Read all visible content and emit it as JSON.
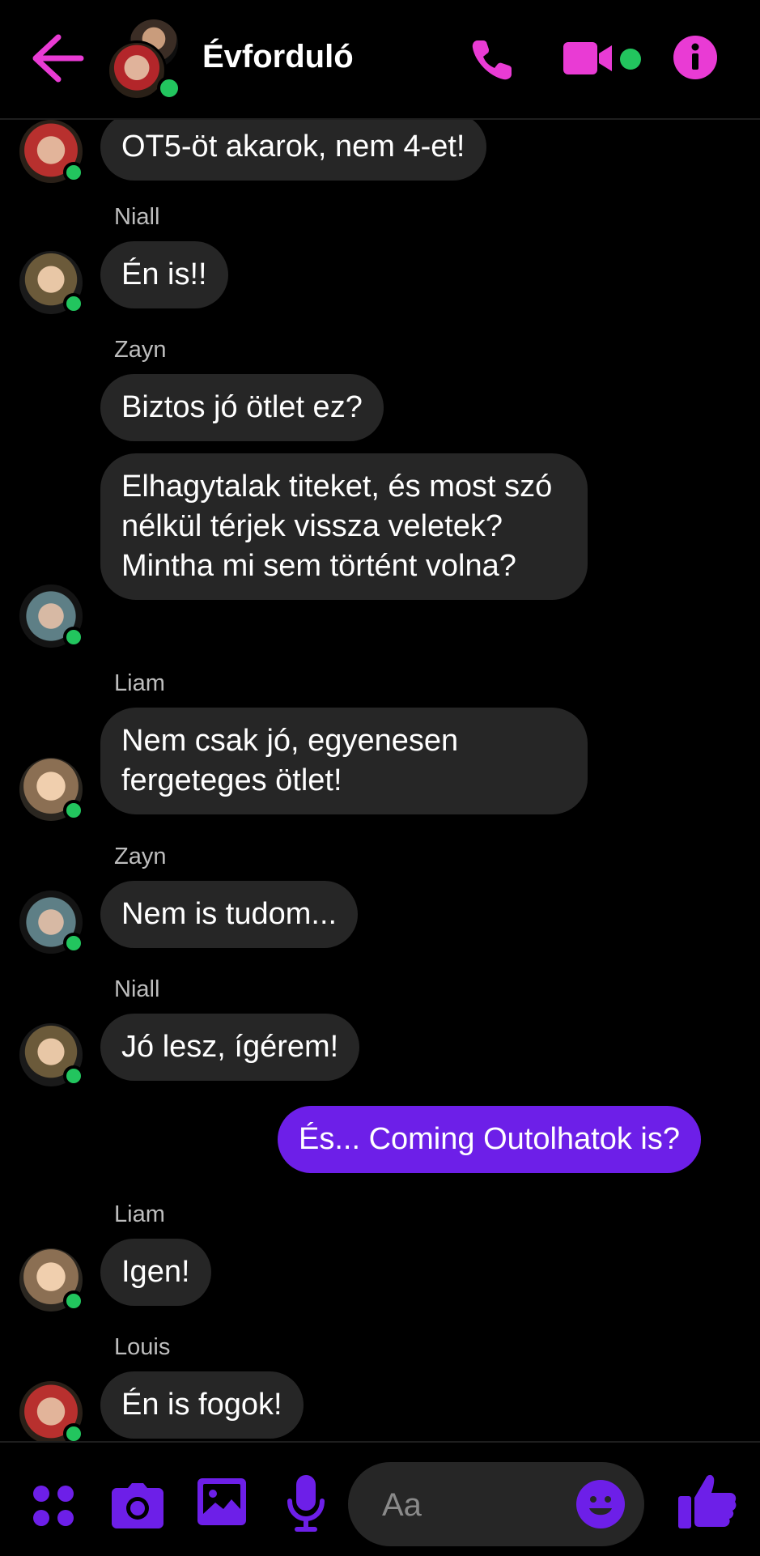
{
  "header": {
    "title": "Évforduló",
    "back_icon": "arrow-left-icon",
    "phone_icon": "phone-icon",
    "video_icon": "video-camera-icon",
    "info_icon": "info-icon",
    "accent_color": "#e93bd4"
  },
  "messages": [
    {
      "sender": "",
      "text": "OT5-öt akarok, nem 4-et!"
    },
    {
      "sender": "Niall",
      "text": "Én is!!"
    },
    {
      "sender": "Zayn",
      "text": "Biztos jó ötlet ez?"
    },
    {
      "sender": "",
      "text": "Elhagytalak titeket, és most szó nélkül térjek vissza veletek? Mintha mi sem történt volna?"
    },
    {
      "sender": "Liam",
      "text": "Nem csak jó, egyenesen fergeteges ötlet!"
    },
    {
      "sender": "Zayn",
      "text": "Nem is tudom..."
    },
    {
      "sender": "Niall",
      "text": "Jó lesz, ígérem!"
    },
    {
      "sender": "",
      "text": "És... Coming Outolhatok is?"
    },
    {
      "sender": "Liam",
      "text": "Igen!"
    },
    {
      "sender": "Louis",
      "text": "Én is fogok!"
    }
  ],
  "composer": {
    "placeholder": "Aa",
    "apps_icon": "apps-grid-icon",
    "camera_icon": "camera-icon",
    "gallery_icon": "image-icon",
    "mic_icon": "microphone-icon",
    "emoji_icon": "smiley-icon",
    "like_icon": "thumbs-up-icon",
    "accent_color": "#6d1fe8"
  },
  "colors": {
    "background": "#000000",
    "incoming_bubble": "#262626",
    "outgoing_bubble": "#6d1fe8",
    "online": "#22c55e"
  }
}
